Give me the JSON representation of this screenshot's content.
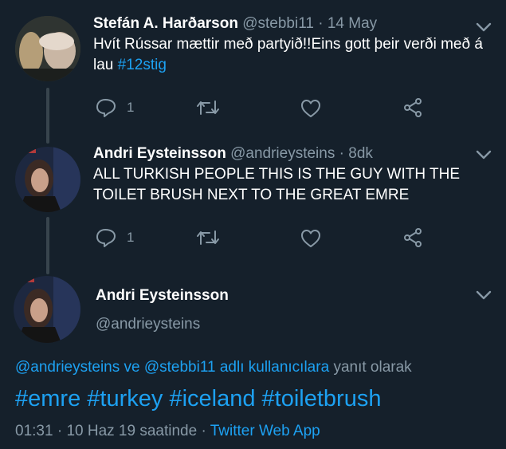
{
  "tweets": [
    {
      "display_name": "Stefán A. Harðarson",
      "handle": "@stebbi11",
      "dot": "·",
      "time": "14 May",
      "text": "Hvít Rússar mættir með partyið!!Eins gott þeir verði með á lau",
      "hashtag": "#12stig",
      "reply_count": "1"
    },
    {
      "display_name": "Andri Eysteinsson",
      "handle": "@andrieysteins",
      "dot": "·",
      "time": "8dk",
      "text_line1": "ALL TURKISH PEOPLE THIS IS THE GUY WITH THE",
      "text_line2": "TOILET BRUSH NEXT TO THE GREAT EMRE",
      "reply_count": "1"
    }
  ],
  "main_tweet": {
    "display_name": "Andri Eysteinsson",
    "handle": "@andrieysteins",
    "reply_to_users": "@andrieysteins ve @stebbi11 adlı kullanıcılara",
    "reply_to_suffix": "yanıt olarak",
    "hashtags": [
      "#emre",
      "#turkey",
      "#iceland",
      "#toiletbrush"
    ],
    "time": "01:31",
    "dot": "·",
    "date": "10 Haz 19 saatinde",
    "dot2": "·",
    "source": "Twitter Web App"
  },
  "colors": {
    "background": "#15202b",
    "accent": "#1da1f2",
    "muted": "#8899a6",
    "thread_line": "#38444d"
  }
}
